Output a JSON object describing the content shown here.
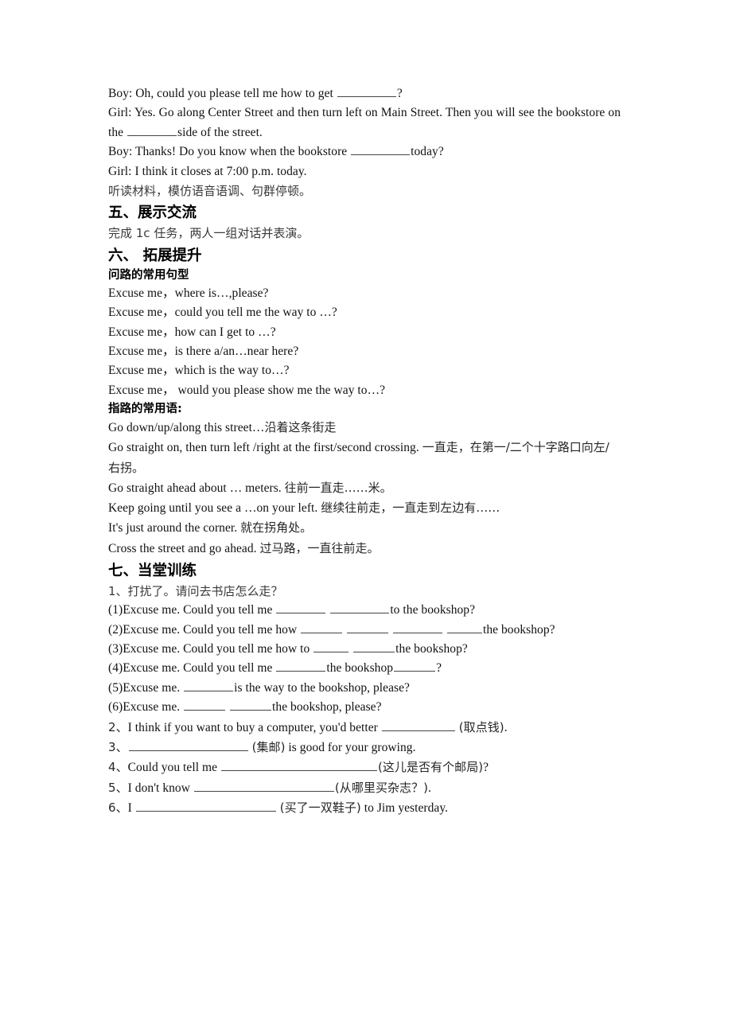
{
  "document": {
    "type": "english-worksheet",
    "language": "mixed-en-zh"
  },
  "dialogue": {
    "line1": "Boy: Oh, could you please tell me how to get ",
    "line1_tail": "?",
    "line2_part1": "Girl: Yes. Go along Center Street and then turn left on Main Street. Then you will see the bookstore on the ",
    "line2_part2": "side of the street.",
    "line3_part1": "Boy: Thanks! Do you know when the bookstore ",
    "line3_part2": "today?",
    "line4": "Girl: I think it closes at 7:00 p.m. today.",
    "instruction": "听读材料，模仿语音语调、句群停顿。"
  },
  "section_five": {
    "heading": "五、展示交流",
    "body": "完成 1c 任务，两人一组对话并表演。"
  },
  "section_six": {
    "heading": "六、 拓展提升",
    "subheading_questions": "问路的常用句型",
    "question_patterns": [
      "Excuse me，where is…,please?",
      "Excuse me，could you tell me the way to …?",
      "Excuse me，how can I get to …?",
      "Excuse me，is there a/an…near here?",
      "Excuse me，which is the way to…?",
      "Excuse me， would you please show me the way to…?"
    ],
    "subheading_directions": "指路的常用语:",
    "direction_phrases": [
      {
        "en": "Go down/up/along this street…",
        "zh": "沿着这条街走"
      },
      {
        "en": "Go straight on, then turn left /right at the first/second crossing. ",
        "zh": "一直走，在第一/二个十字路口向左/右拐。"
      },
      {
        "en": "Go straight ahead about … meters. ",
        "zh": "往前一直走……米。"
      },
      {
        "en": "Keep going until you see a …on your left. ",
        "zh": "继续往前走，一直走到左边有……"
      },
      {
        "en": "It's just around the corner. ",
        "zh": "就在拐角处。"
      },
      {
        "en": "Cross the street and go ahead. ",
        "zh": "过马路，一直往前走。"
      }
    ]
  },
  "section_seven": {
    "heading": "七、当堂训练",
    "item1": {
      "prompt": "1、打扰了。请问去书店怎么走？",
      "subitems": [
        {
          "label": "(1)",
          "before": "Excuse me. Could you tell me ",
          "after": "to the bookshop?",
          "blanks": [
            "b-lg",
            "b-xl"
          ]
        },
        {
          "label": "(2)",
          "before": "Excuse me. Could you tell me how ",
          "after": "the bookshop?",
          "blanks": [
            "b-md",
            "b-md",
            "b-lg",
            "b-sm"
          ]
        },
        {
          "label": "(3)",
          "before": "Excuse me. Could you tell me how to ",
          "after": "the bookshop?",
          "blanks": [
            "b-sm",
            "b-md"
          ]
        },
        {
          "label": "(4)",
          "before": "Excuse me. Could you tell me ",
          "mid": "the bookshop",
          "after": "?",
          "blanks": [
            "b-lg",
            "b-md"
          ]
        },
        {
          "label": "(5)",
          "before": "Excuse me. ",
          "after": "is the way to the bookshop, please?",
          "blanks": [
            "b-lg"
          ]
        },
        {
          "label": "(6)",
          "before": "Excuse me. ",
          "after": "the bookshop, please?",
          "blanks": [
            "b-md",
            "b-md"
          ]
        }
      ]
    },
    "item2": {
      "label": "2、",
      "before": "I think if you want to buy a computer, you'd better ",
      "zh": "(取点钱)",
      "after": ".",
      "blank": "b-2x"
    },
    "item3": {
      "label": "3、",
      "zh": "(集邮)",
      "after": " is good for your growing.",
      "blank": "b-3x"
    },
    "item4": {
      "label": "4、",
      "before": "Could you tell me ",
      "zh": "(这儿是否有个邮局)",
      "after": "?",
      "blank": "b-5x"
    },
    "item5": {
      "label": "5、",
      "before": "I don't know ",
      "zh": "(从哪里买杂志？)",
      "after": ".",
      "blank": "b-4x"
    },
    "item6": {
      "label": "6、",
      "before": "I ",
      "zh": "(买了一双鞋子)",
      "after": " to Jim yesterday.",
      "blank": "b-4x"
    }
  }
}
